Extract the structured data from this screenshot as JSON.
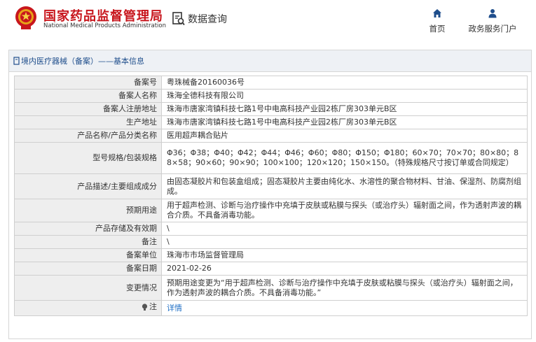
{
  "header": {
    "title_cn": "国家药品监督管理局",
    "title_en": "National Medical Products Administration",
    "data_query": "数据查询",
    "nav": [
      {
        "label": "首页",
        "icon": "home-icon"
      },
      {
        "label": "政务服务门户",
        "icon": "user-icon"
      }
    ]
  },
  "breadcrumb": "境内医疗器械（备案）——基本信息",
  "rows": [
    {
      "label": "备案号",
      "value": "粤珠械备20160036号"
    },
    {
      "label": "备案人名称",
      "value": "珠海全德科技有限公司"
    },
    {
      "label": "备案人注册地址",
      "value": "珠海市唐家湾镇科技七路1号中电高科技产业园2栋厂房303单元B区"
    },
    {
      "label": "生产地址",
      "value": "珠海市唐家湾镇科技七路1号中电高科技产业园2栋厂房303单元B区"
    },
    {
      "label": "产品名称/产品分类名称",
      "value": "医用超声耦合贴片"
    },
    {
      "label": "型号规格/包装规格",
      "value": "Φ36；Φ38；Φ40；Φ42；Φ44；Φ46；Φ60；Φ80；Φ150；Φ180；60×70；70×70；80×80；88×58；90×60；90×90；100×100；120×120；150×150。（特殊规格尺寸按订单或合同规定）"
    },
    {
      "label": "产品描述/主要组成成分",
      "value": "由固态凝胶片和包装盒组成；固态凝胶片主要由纯化水、水溶性的聚合物材料、甘油、保湿剂、防腐剂组成。"
    },
    {
      "label": "预期用途",
      "value": "用于超声检测、诊断与治疗操作中充填于皮肤或粘膜与探头（或治疗头）辐射面之间，作为透射声波的耦合介质。不具备消毒功能。"
    },
    {
      "label": "产品存储及有效期",
      "value": "\\"
    },
    {
      "label": "备注",
      "value": "\\"
    },
    {
      "label": "备案单位",
      "value": "珠海市市场监督管理局"
    },
    {
      "label": "备案日期",
      "value": "2021-02-26"
    },
    {
      "label": "变更情况",
      "value": "预期用途变更为“用于超声检测、诊断与治疗操作中充填于皮肤或粘膜与探头（或治疗头）辐射面之间，作为透射声波的耦合介质。不具备消毒功能。”"
    },
    {
      "label": "注",
      "value": "详情",
      "icon": "lightbulb-icon"
    }
  ],
  "colors": {
    "brand_red": "#c8161d",
    "nav_blue": "#1f4e8c",
    "link_blue": "#1f6fc5"
  }
}
